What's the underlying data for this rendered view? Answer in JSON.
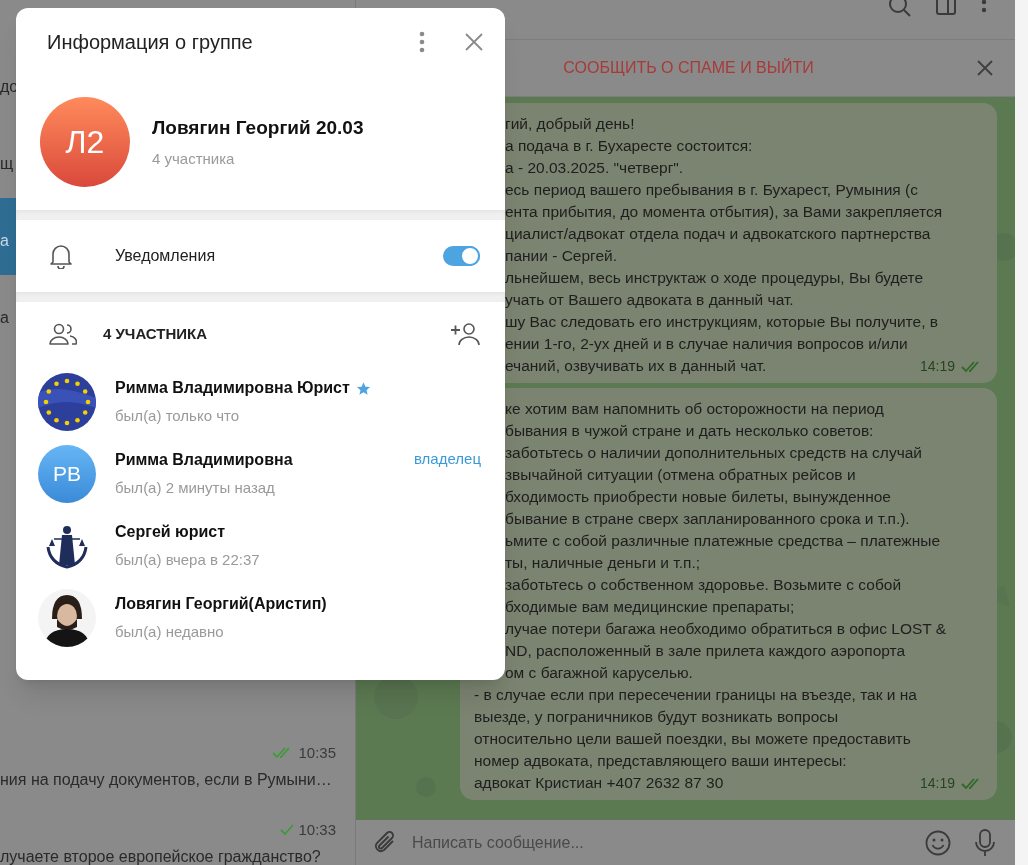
{
  "chat_list": {
    "items_top": [
      {
        "preview": "до",
        "selected": false
      },
      {
        "preview": "щ",
        "selected": false
      },
      {
        "preview": "а",
        "selected": true
      },
      {
        "preview": "а",
        "selected": false
      }
    ],
    "items_bottom": [
      {
        "time": "10:35",
        "read": true,
        "preview": "ния на подачу документов, если в Румыни…"
      },
      {
        "time": "10:33",
        "read": false,
        "preview": "лучаете второе европейское гражданство?"
      }
    ]
  },
  "chat": {
    "spam_bar": "СООБЩИТЬ О СПАМЕ И ВЫЙТИ",
    "messages": [
      {
        "fragments": [
          "гий, добрый день!",
          "а подача в г. Бухаресте состоится:",
          "а - 20.03.2025. \"четверг\".",
          "есь период вашего пребывания в г. Бухарест, Румыния (с",
          "ента прибытия, до момента отбытия), за Вами закрепляется",
          "циалист/адвокат отдела подач и адвокатского партнерства",
          "пании - Сергей.",
          "льнейшем, весь инструктаж о ходе процедуры, Вы будете",
          "учать от Вашего адвоката в данный чат.",
          "шу Вас следовать его инструкциям, которые Вы получите, в",
          "ении 1-го, 2-ух дней и в случае наличия вопросов и/или",
          "ечаний, озвучивать их в данный чат."
        ],
        "time": "14:19",
        "read": true
      },
      {
        "fragments": [
          "ке хотим вам напомнить об осторожности на период",
          "бывания в чужой стране и дать несколько советов:",
          "заботьтесь о наличии дополнительных средств на случай",
          "звычайной ситуации (отмена обратных рейсов и",
          "бходимость приобрести новые билеты, вынужденное",
          "бывание в стране сверх запланированного срока и т.п.).",
          "ьмите с собой различные платежные средства – платежные",
          "ты, наличные деньги и т.п.;",
          "заботьтесь о собственном здоровье. Возьмите с собой",
          "бходимые вам медицинские препараты;",
          "лучае потери багажа необходимо обратиться в офис LOST &",
          "ND, расположенный в зале прилета каждого аэропорта",
          "ом с багажной каруселью."
        ],
        "lines": [
          "- в случае если при пересечении границы на въезде, так и на",
          "выезде, у пограничников будут возникать вопросы",
          "относительно цели вашей поездки, вы можете предоставить",
          "номер адвоката, представляющего ваши интересы:",
          "адвокат Кристиан +407 2632 87 30"
        ],
        "time": "14:19",
        "read": true
      }
    ],
    "composer": {
      "placeholder": "Написать сообщение..."
    }
  },
  "group_info": {
    "title": "Информация о группе",
    "avatar_initials": "Л2",
    "name": "Ловягин Георгий 20.03",
    "subtitle": "4 участника",
    "notifications": {
      "label": "Уведомления",
      "on": true
    },
    "members_header": "4 УЧАСТНИКА",
    "members": [
      {
        "name": "Римма Владимировна Юрист",
        "status": "был(а) только что",
        "star": true
      },
      {
        "name": "Римма Владимировна",
        "status": "был(а) 2 минуты назад",
        "role": "владелец",
        "star": false,
        "avatar": {
          "kind": "initials",
          "initials": "РВ"
        }
      },
      {
        "name": "Сергей юрист",
        "status": "был(а) вчера в 22:37",
        "star": false
      },
      {
        "name": "Ловягин Георгий(Аристип)",
        "status": "был(а) недавно",
        "star": false
      }
    ]
  }
}
